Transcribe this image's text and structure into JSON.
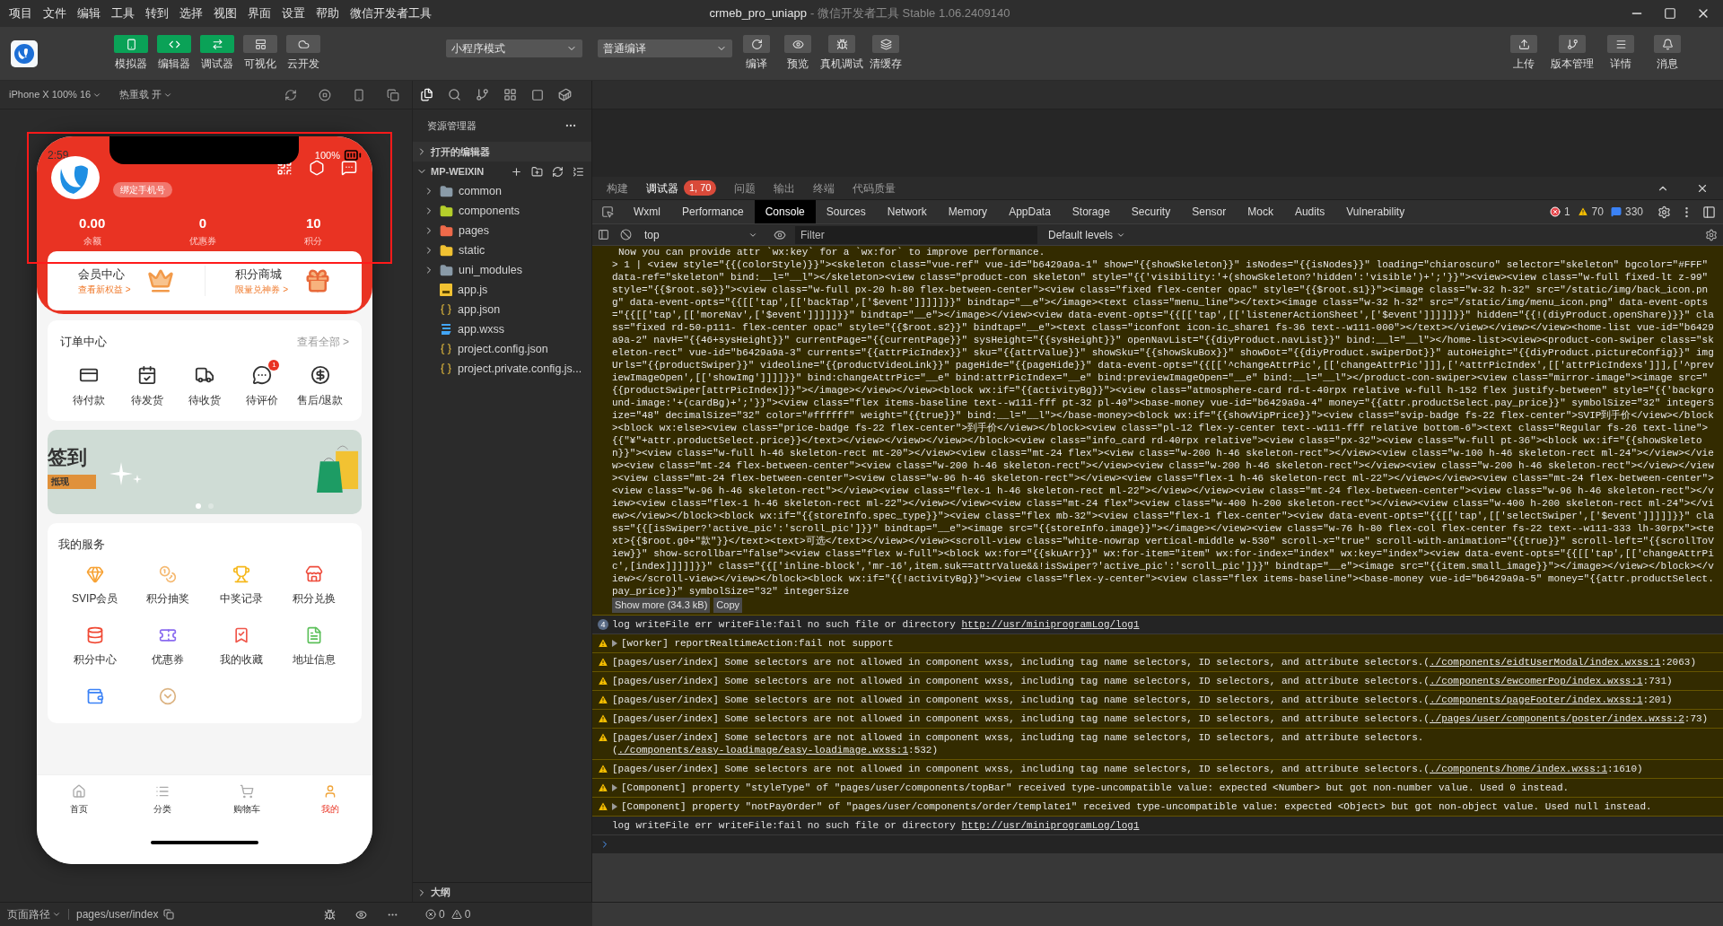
{
  "menu_bar": {
    "menus": [
      "项目",
      "文件",
      "编辑",
      "工具",
      "转到",
      "选择",
      "视图",
      "界面",
      "设置",
      "帮助",
      "微信开发者工具"
    ],
    "title": "crmeb_pro_uniapp",
    "subtitle": "- 微信开发者工具 Stable 1.06.2409140"
  },
  "toolbar": {
    "view_buttons": [
      {
        "label": "模拟器",
        "selected": true
      },
      {
        "label": "编辑器",
        "selected": true
      },
      {
        "label": "调试器",
        "selected": true
      },
      {
        "label": "可视化",
        "selected": false
      },
      {
        "label": "云开发",
        "selected": false
      }
    ],
    "mode_select": "小程序模式",
    "compile_select": "普通编译",
    "actions": [
      "编译",
      "预览",
      "真机调试",
      "清缓存"
    ],
    "right_actions": [
      "上传",
      "版本管理",
      "详情",
      "消息"
    ]
  },
  "simulator": {
    "device": "iPhone X 100% 16",
    "hot_reload": "热重载 开",
    "phone": {
      "time": "2:59",
      "battery": "100%",
      "bind_phone": "绑定手机号",
      "stats": [
        {
          "value": "0.00",
          "label": "余额"
        },
        {
          "value": "0",
          "label": "优惠券"
        },
        {
          "value": "10",
          "label": "积分"
        }
      ],
      "promos": [
        {
          "title": "会员中心",
          "subtitle": "查看新权益 >"
        },
        {
          "title": "积分商城",
          "subtitle": "限量兑神券 >"
        }
      ],
      "orders": {
        "title": "订单中心",
        "link": "查看全部 >",
        "items": [
          {
            "label": "待付款"
          },
          {
            "label": "待发货"
          },
          {
            "label": "待收货"
          },
          {
            "label": "待评价",
            "badge": "1"
          },
          {
            "label": "售后/退款"
          }
        ]
      },
      "banner": {
        "title": "签到",
        "tag": "抵现",
        "dots": [
          {
            "selected": true
          },
          {
            "selected": false
          }
        ]
      },
      "services": {
        "title": "我的服务",
        "items": [
          {
            "kind": "labeled",
            "label": "SVIP会员",
            "color": "#f7a234"
          },
          {
            "kind": "labeled",
            "label": "积分抽奖",
            "color": "#f5b971"
          },
          {
            "kind": "labeled",
            "label": "中奖记录",
            "color": "#f6b81c"
          },
          {
            "kind": "labeled",
            "label": "积分兑换",
            "color": "#ee4c3c"
          },
          {
            "kind": "labeled",
            "label": "积分中心",
            "color": "#f04a35"
          },
          {
            "kind": "labeled",
            "label": "优惠券",
            "color": "#8b6cf0"
          },
          {
            "kind": "labeled",
            "label": "我的收藏",
            "color": "#f0564a"
          },
          {
            "kind": "labeled",
            "label": "地址信息",
            "color": "#5cc05a"
          },
          {
            "kind": "icon",
            "color": "#3b82f6"
          },
          {
            "kind": "icon",
            "color": "#dcb382"
          }
        ]
      },
      "tabbar": [
        {
          "label": "首页",
          "selected": false
        },
        {
          "label": "分类",
          "selected": false
        },
        {
          "label": "购物车",
          "selected": false
        },
        {
          "label": "我的",
          "selected": true
        }
      ]
    }
  },
  "explorer": {
    "title": "资源管理器",
    "open_editors": {
      "label": "打开的编辑器",
      "expanded": false
    },
    "project": {
      "label": "MP-WEIXIN",
      "expanded": true
    },
    "items": [
      {
        "kind": "folder",
        "name": "common",
        "color": "#8a9ba8",
        "expanded": false
      },
      {
        "kind": "folder",
        "name": "components",
        "color": "#b5cf2b",
        "expanded": false
      },
      {
        "kind": "folder",
        "name": "pages",
        "color": "#ef6a4a",
        "expanded": false
      },
      {
        "kind": "folder",
        "name": "static",
        "color": "#f1c232",
        "expanded": false
      },
      {
        "kind": "folder",
        "name": "uni_modules",
        "color": "#8a9ba8",
        "expanded": false
      },
      {
        "kind": "js",
        "name": "app.js"
      },
      {
        "kind": "json",
        "name": "app.json"
      },
      {
        "kind": "css",
        "name": "app.wxss"
      },
      {
        "kind": "json",
        "name": "project.config.json"
      },
      {
        "kind": "json",
        "name": "project.private.config.js..."
      }
    ],
    "outline": {
      "label": "大纲",
      "expanded": false
    }
  },
  "devtools": {
    "top_tabs": [
      {
        "label": "构建",
        "selected": false
      },
      {
        "label": "调试器",
        "selected": true,
        "badge": "1, 70"
      },
      {
        "label": "问题",
        "selected": false
      },
      {
        "label": "输出",
        "selected": false
      },
      {
        "label": "终端",
        "selected": false
      },
      {
        "label": "代码质量",
        "selected": false
      }
    ],
    "panel_tabs": [
      {
        "label": "Wxml",
        "selected": false
      },
      {
        "label": "Performance",
        "selected": false
      },
      {
        "label": "Console",
        "selected": true
      },
      {
        "label": "Sources",
        "selected": false
      },
      {
        "label": "Network",
        "selected": false
      },
      {
        "label": "Memory",
        "selected": false
      },
      {
        "label": "AppData",
        "selected": false
      },
      {
        "label": "Storage",
        "selected": false
      },
      {
        "label": "Security",
        "selected": false
      },
      {
        "label": "Sensor",
        "selected": false
      },
      {
        "label": "Mock",
        "selected": false
      },
      {
        "label": "Audits",
        "selected": false
      },
      {
        "label": "Vulnerability",
        "selected": false
      }
    ],
    "counts": {
      "errors": "1",
      "warnings": "70",
      "messages": "330"
    },
    "context": "top",
    "filter_placeholder": "Filter",
    "levels": "Default levels",
    "messages": [
      {
        "kind": "code",
        "note": "Now you can provide attr `wx:key` for a `wx:for` to improve performance.",
        "code": "> 1 | <view style=\"{{(colorStyle)}}\"><skeleton class=\"vue-ref\" vue-id=\"b6429a9a-1\" show=\"{{showSkeleton}}\" isNodes=\"{{isNodes}}\" loading=\"chiaroscuro\" selector=\"skeleton\" bgcolor=\"#FFF\" data-ref=\"skeleton\" bind:__l=\"__l\"></skeleton><view class=\"product-con skeleton\" style=\"{{'visibility:'+(showSkeleton?'hidden':'visible')+';'}}\"><view><view class=\"w-full fixed-lt z-99\" style=\"{{$root.s0}}\"><view class=\"w-full px-20 h-80 flex-between-center\"><view class=\"fixed flex-center opac\" style=\"{{$root.s1}}\"><image class=\"w-32 h-32\" src=\"/static/img/back_icon.png\" data-event-opts=\"{{[['tap',[['backTap',['$event']]]]]}}\" bindtap=\"__e\"></image><text class=\"menu_line\"></text><image class=\"w-32 h-32\" src=\"/static/img/menu_icon.png\" data-event-opts=\"{{[['tap',[['moreNav',['$event']]]]]}}\" bindtap=\"__e\"></image></view><view data-event-opts=\"{{[['tap',[['listenerActionSheet',['$event']]]]]}}\" hidden=\"{{!(diyProduct.openShare)}}\" class=\"fixed rd-50-p111- flex-center opac\" style=\"{{$root.s2}}\" bindtap=\"__e\"><text class=\"iconfont icon-ic_share1 fs-36 text--w111-000\"></text></view></view></view><home-list vue-id=\"b6429a9a-2\" navH=\"{{46+sysHeight}}\" currentPage=\"{{currentPage}}\" sysHeight=\"{{sysHeight}}\" openNavList=\"{{diyProduct.navList}}\" bind:__l=\"__l\"></home-list><view><product-con-swiper class=\"skeleton-rect\" vue-id=\"b6429a9a-3\" currents=\"{{attrPicIndex}}\" sku=\"{{attrValue}}\" showSku=\"{{showSkuBox}}\" showDot=\"{{diyProduct.swiperDot}}\" autoHeight=\"{{diyProduct.pictureConfig}}\" imgUrls=\"{{productSwiper}}\" videoline=\"{{productVideoLink}}\" pageHide=\"{{pageHide}}\" data-event-opts=\"{{[['^changeAttrPic',[['changeAttrPic']]],['^attrPicIndex',[['attrPicIndexs']]],['^previewImageOpen',[['showImg']]]]}}\" bind:changeAttrPic=\"__e\" bind:attrPicIndex=\"__e\" bind:previewImageOpen=\"__e\" bind:__l=\"__l\"></product-con-swiper><view class=\"mirror-image\"><image src=\"{{productSwiper[attrPicIndex]}}\"></image></view></view><block wx:if=\"{{activityBg}}\"><view class=\"atmosphere-card rd-t-40rpx relative w-full h-152 flex justify-between\" style=\"{{'background-image:'+(cardBg)+';'}}\"><view class=\"flex items-baseline text--w111-fff pt-32 pl-40\"><base-money vue-id=\"b6429a9a-4\" money=\"{{attr.productSelect.pay_price}}\" symbolSize=\"32\" integerSize=\"48\" decimalSize=\"32\" color=\"#ffffff\" weight=\"{{true}}\" bind:__l=\"__l\"></base-money><block wx:if=\"{{showVipPrice}}\"><view class=\"svip-badge fs-22 flex-center\">SVIP到手价</view></block><block wx:else><view class=\"price-badge fs-22 flex-center\">到手价</view></block><view class=\"pl-12 flex-y-center text--w111-fff relative bottom-6\"><text class=\"Regular fs-26 text-line\">{{\"¥\"+attr.productSelect.price}}</text></view></view></view></block><view class=\"info_card rd-40rpx relative\"><view class=\"px-32\"><view class=\"w-full pt-36\"><block wx:if=\"{{showSkeleton}}\"><view class=\"w-full h-46 skeleton-rect mt-20\"></view><view class=\"mt-24 flex\"><view class=\"w-200 h-46 skeleton-rect\"></view><view class=\"w-100 h-46 skeleton-rect ml-24\"></view></view><view class=\"mt-24 flex-between-center\"><view class=\"w-200 h-46 skeleton-rect\"></view><view class=\"w-200 h-46 skeleton-rect\"></view><view class=\"w-200 h-46 skeleton-rect\"></view></view><view class=\"mt-24 flex-between-center\"><view class=\"w-96 h-46 skeleton-rect\"></view><view class=\"flex-1 h-46 skeleton-rect ml-22\"></view></view><view class=\"mt-24 flex-between-center\"><view class=\"w-96 h-46 skeleton-rect\"></view><view class=\"flex-1 h-46 skeleton-rect ml-22\"></view></view><view class=\"mt-24 flex-between-center\"><view class=\"w-96 h-46 skeleton-rect\"></view><view class=\"flex-1 h-46 skeleton-rect ml-22\"></view></view><view class=\"mt-24 flex\"><view class=\"w-400 h-200 skeleton-rect\"></view><view class=\"w-400 h-200 skeleton-rect ml-24\"></view></view></block><block wx:if=\"{{storeInfo.spec_type}}\"><view class=\"flex mb-32\"><view class=\"flex-1 flex-center\"><view data-event-opts=\"{{[['tap',[['selectSwiper',['$event']]]]]}}\" class=\"{{[isSwiper?'active_pic':'scroll_pic']}}\" bindtap=\"__e\"><image src=\"{{storeInfo.image}}\"></image></view><view class=\"w-76 h-80 flex-col flex-center fs-22 text--w111-333 lh-30rpx\"><text>{{$root.g0+\"款\"}}</text><text>可选</text></view></view><scroll-view class=\"white-nowrap vertical-middle w-530\" scroll-x=\"true\" scroll-with-animation=\"{{true}}\" scroll-left=\"{{scrollToView}}\" show-scrollbar=\"false\"><view class=\"flex w-full\"><block wx:for=\"{{skuArr}}\" wx:for-item=\"item\" wx:for-index=\"index\" wx:key=\"index\"><view data-event-opts=\"{{[['tap',[['changeAttrPic',[index]]]]]}}\" class=\"{{['inline-block','mr-16',item.suk==attrValue&&!isSwiper?'active_pic':'scroll_pic']}}\" bindtap=\"__e\"><image src=\"{{item.small_image}}\"></image></view></block></view></scroll-view></view></block><block wx:if=\"{{!activityBg}}\"><view class=\"flex-y-center\"><view class=\"flex items-baseline\"><base-money vue-id=\"b6429a9a-5\" money=\"{{attr.productSelect.pay_price}}\" symbolSize=\"32\" integerSize",
        "show_more": "Show more (34.3 kB)",
        "copy": "Copy"
      },
      {
        "kind": "log",
        "count": "4",
        "text": "log writeFile err writeFile:fail no such file or directory ",
        "link": "http://usr/miniprogramLog/log1"
      },
      {
        "kind": "warning",
        "expandable": true,
        "text": "[worker] reportRealtimeAction:fail not support"
      },
      {
        "kind": "warning",
        "expandable": false,
        "text": "[pages/user/index] Some selectors are not allowed in component wxss, including tag name selectors, ID selectors, and attribute selectors.(",
        "link": "./components/eidtUserModal/index.wxss:1",
        "after": ":2063)"
      },
      {
        "kind": "warning",
        "expandable": false,
        "text": "[pages/user/index] Some selectors are not allowed in component wxss, including tag name selectors, ID selectors, and attribute selectors.(",
        "link": "./components/ewcomerPop/index.wxss:1",
        "after": ":731)"
      },
      {
        "kind": "warning",
        "expandable": false,
        "text": "[pages/user/index] Some selectors are not allowed in component wxss, including tag name selectors, ID selectors, and attribute selectors.(",
        "link": "./components/pageFooter/index.wxss:1",
        "after": ":201)"
      },
      {
        "kind": "warning",
        "expandable": false,
        "text": "[pages/user/index] Some selectors are not allowed in component wxss, including tag name selectors, ID selectors, and attribute selectors.(",
        "link": "./pages/user/components/poster/index.wxss:2",
        "after": ":73)"
      },
      {
        "kind": "warning",
        "expandable": false,
        "text": "[pages/user/index] Some selectors are not allowed in component wxss, including tag name selectors, ID selectors, and attribute selectors.(",
        "link": "./components/easy-loadimage/easy-loadimage.wxss:1",
        "after": ":532)"
      },
      {
        "kind": "warning",
        "expandable": false,
        "text": "[pages/user/index] Some selectors are not allowed in component wxss, including tag name selectors, ID selectors, and attribute selectors.(",
        "link": "./components/home/index.wxss:1",
        "after": ":1610)"
      },
      {
        "kind": "warning",
        "expandable": true,
        "text": "[Component] property \"styleType\" of \"pages/user/components/topBar\" received type-uncompatible value: expected <Number> but got non-number value. Used 0 instead."
      },
      {
        "kind": "warning",
        "expandable": true,
        "text": "[Component] property \"notPayOrder\" of \"pages/user/components/order/template1\" received type-uncompatible value: expected <Object> but got non-object value. Used null instead."
      },
      {
        "kind": "log",
        "text": "log writeFile err writeFile:fail no such file or directory ",
        "link": "http://usr/miniprogramLog/log1"
      }
    ]
  },
  "status_bar": {
    "path_label": "页面路径",
    "path": "pages/user/index",
    "errors": "0",
    "warnings": "0"
  }
}
